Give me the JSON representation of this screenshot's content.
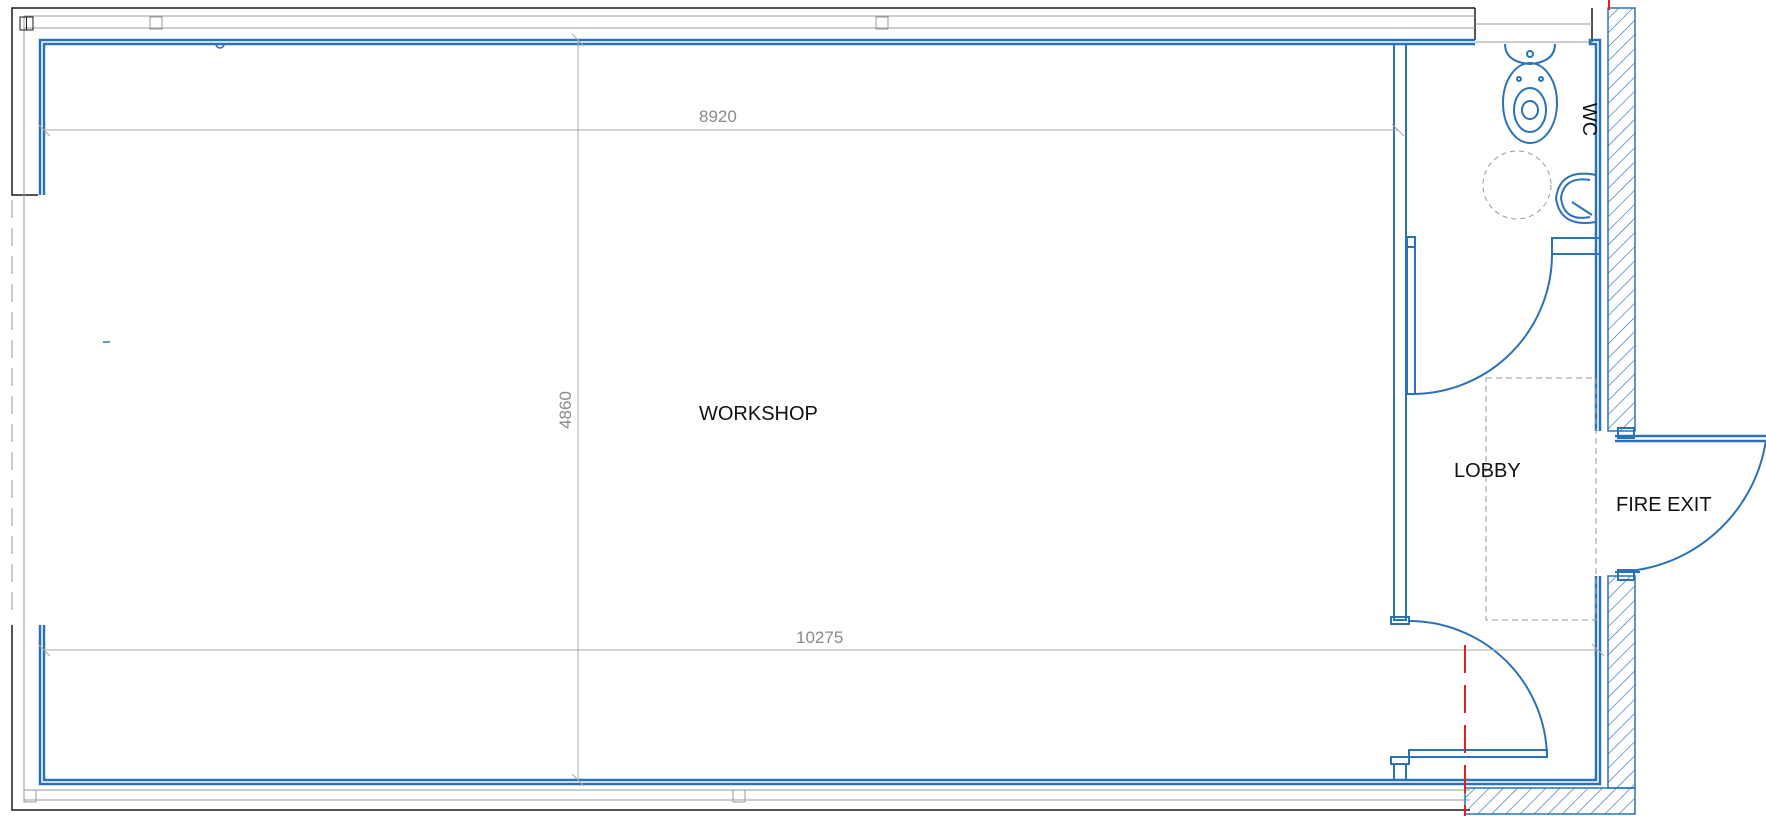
{
  "rooms": {
    "workshop": "WORKSHOP",
    "lobby": "LOBBY",
    "wc": "WC",
    "fire_exit": "FIRE EXIT"
  },
  "dimensions": {
    "inner_length": "8920",
    "overall_length": "10275",
    "width": "4860"
  },
  "colors": {
    "wall": "#2a72b8",
    "structure": "#1a1a1a",
    "dimension": "#9a9a9a",
    "marker": "#e02020",
    "hatch": "#2a72b8"
  }
}
